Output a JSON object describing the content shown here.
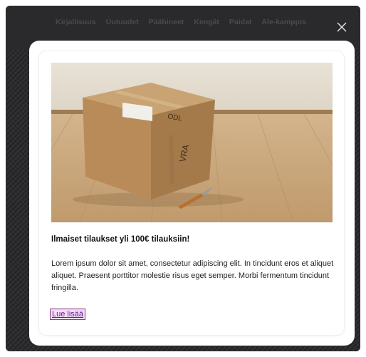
{
  "nav": {
    "items": [
      {
        "label": "Kirjallisuus"
      },
      {
        "label": "Uutuudet"
      },
      {
        "label": "Päähineet"
      },
      {
        "label": "Kengät"
      },
      {
        "label": "Paidat"
      },
      {
        "label": "Ale-kamppis"
      }
    ]
  },
  "close_icon": "close-icon",
  "modal": {
    "image_icon": "cardboard-box-photo",
    "title": "Ilmaiset tilaukset yli 100€ tilauksiin!",
    "body": "Lorem ipsum dolor sit amet, consectetur adipiscing elit. In tincidunt eros et aliquet aliquet. Praesent porttitor molestie risus eget semper. Morbi fermentum tincidunt fringilla.",
    "link_label": "Lue lisää"
  },
  "colors": {
    "backdrop": "#262628",
    "link": "#6a1b9a",
    "link_highlight": "#f3dcf3"
  }
}
